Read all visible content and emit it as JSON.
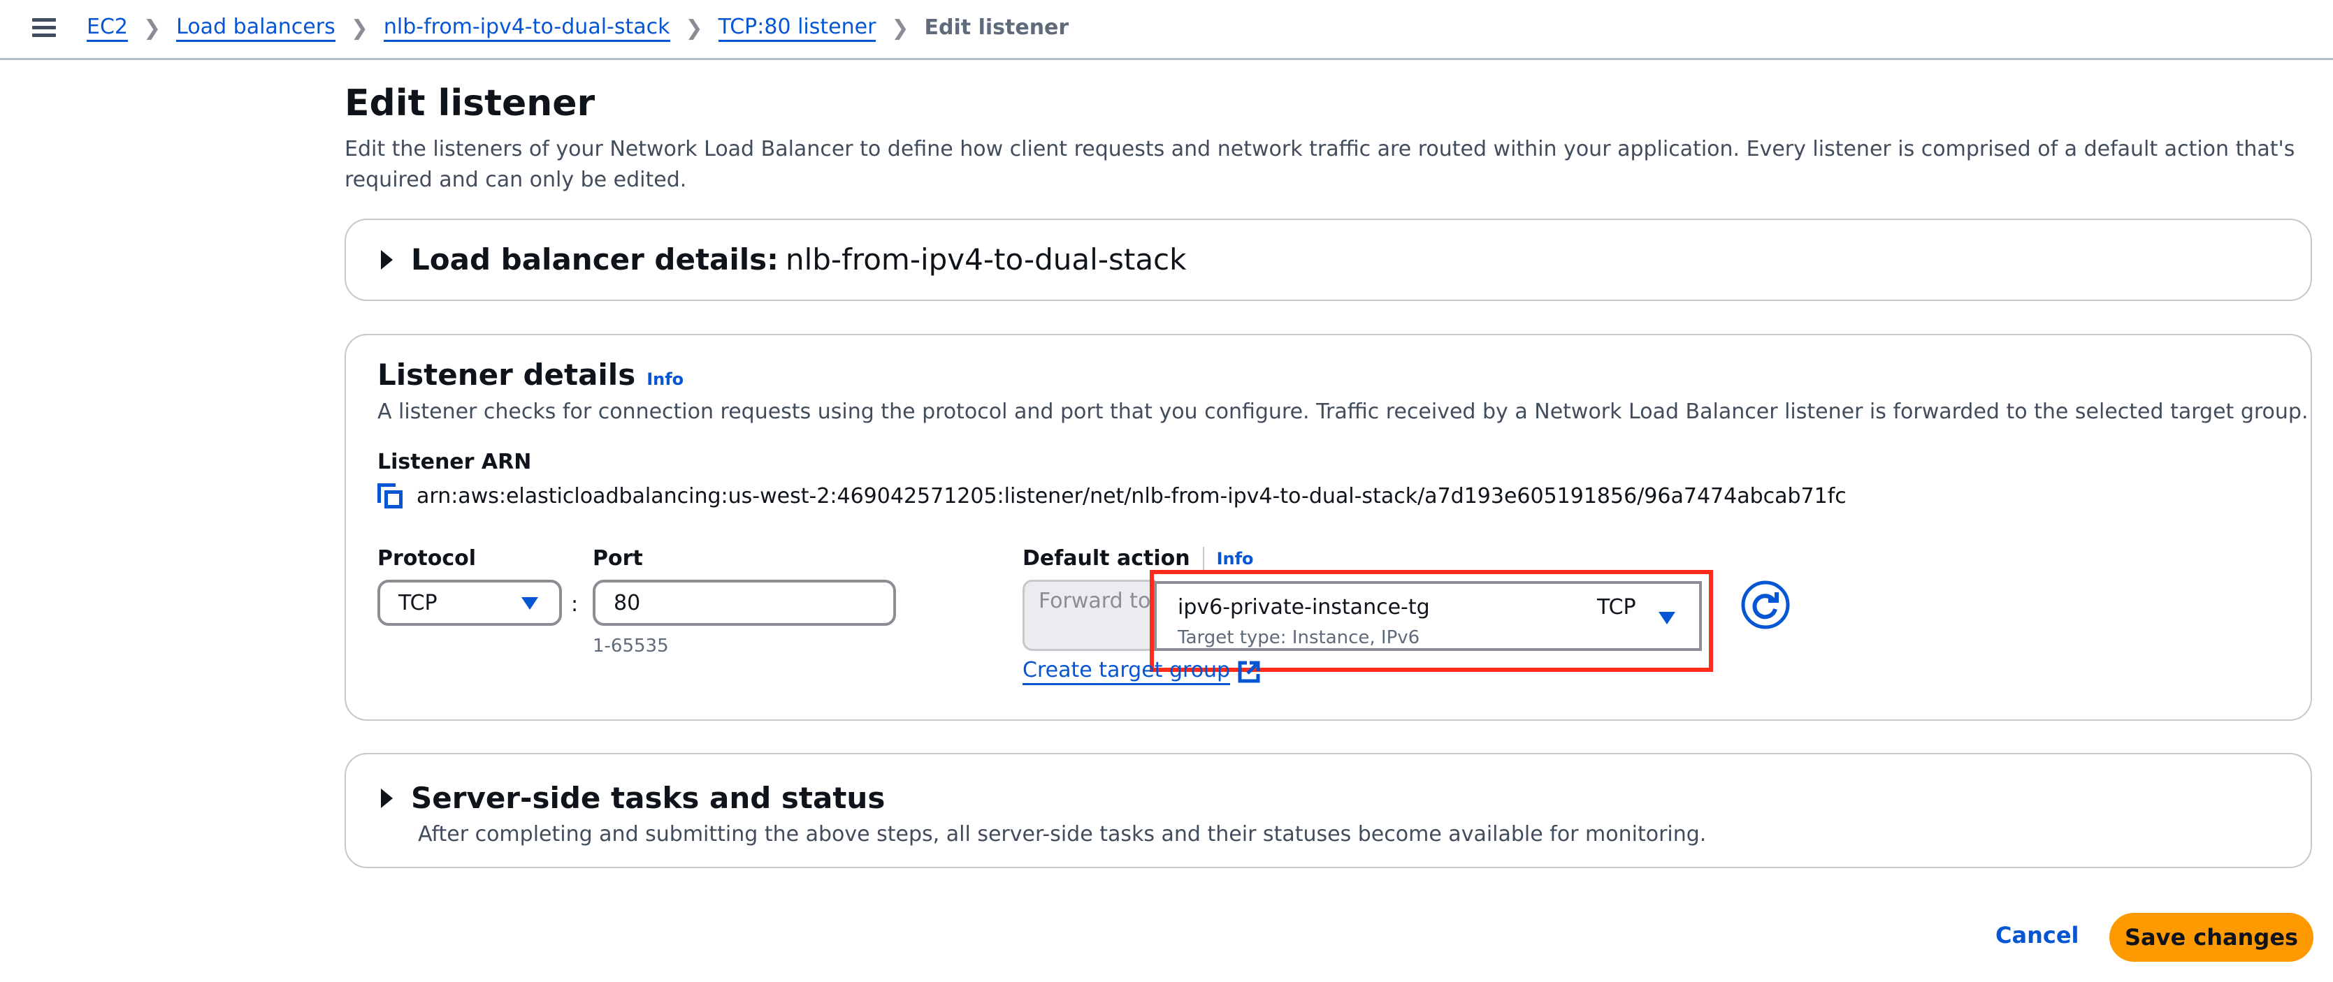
{
  "breadcrumb": {
    "items": [
      {
        "label": "EC2"
      },
      {
        "label": "Load balancers"
      },
      {
        "label": "nlb-from-ipv4-to-dual-stack"
      },
      {
        "label": "TCP:80 listener"
      }
    ],
    "current": "Edit listener"
  },
  "page": {
    "title": "Edit listener",
    "description": "Edit the listeners of your Network Load Balancer to define how client requests and network traffic are routed within your application. Every listener is comprised of a default action that's required and can only be edited."
  },
  "lb_details": {
    "label": "Load balancer details:",
    "name": "nlb-from-ipv4-to-dual-stack"
  },
  "listener_details": {
    "title": "Listener details",
    "info": "Info",
    "description": "A listener checks for connection requests using the protocol and port that you configure. Traffic received by a Network Load Balancer listener is forwarded to the selected target group.",
    "arn_label": "Listener ARN",
    "arn_value": "arn:aws:elasticloadbalancing:us-west-2:469042571205:listener/net/nlb-from-ipv4-to-dual-stack/a7d193e605191856/96a7474abcab71fc",
    "protocol_label": "Protocol",
    "protocol_value": "TCP",
    "colon": ":",
    "port_label": "Port",
    "port_value": "80",
    "port_hint": "1-65535",
    "default_action_label": "Default action",
    "default_action_info": "Info",
    "forward_to": "Forward to",
    "target_group": {
      "name": "ipv6-private-instance-tg",
      "protocol": "TCP",
      "subtitle": "Target type: Instance, IPv6"
    },
    "create_target_group": "Create target group"
  },
  "server_tasks": {
    "title": "Server-side tasks and status",
    "description": "After completing and submitting the above steps, all server-side tasks and their statuses become available for monitoring."
  },
  "actions": {
    "cancel": "Cancel",
    "save": "Save changes"
  },
  "colors": {
    "link": "#0656d3",
    "primary_button": "#ff9900",
    "highlight": "#ff2a1a"
  }
}
